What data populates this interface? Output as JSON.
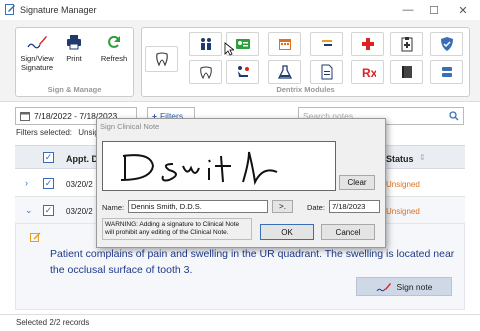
{
  "window": {
    "title": "Signature Manager",
    "min": "—",
    "max": "☐",
    "close": "✕"
  },
  "ribbon": {
    "sign_manage": {
      "label": "Sign & Manage",
      "buttons": [
        {
          "label": "Sign/View Signature",
          "icon": "pen-signature-icon"
        },
        {
          "label": "Print",
          "icon": "printer-icon"
        },
        {
          "label": "Refresh",
          "icon": "refresh-icon"
        }
      ]
    },
    "dentrix_modules": {
      "label": "Dentrix Modules"
    }
  },
  "filter": {
    "date_range": "7/18/2022 - 7/18/2023",
    "filters_label": "Filters",
    "search_placeholder": "Search notes",
    "selected_label": "Filters selected:",
    "selected_value": "Unsig"
  },
  "table": {
    "columns": [
      "Appt. D",
      "Status"
    ],
    "rows": [
      {
        "date": "03/20/2",
        "status": "Unsigned"
      },
      {
        "date": "03/20/2",
        "status": "Unsigned"
      }
    ]
  },
  "note": {
    "text": "Patient complains of pain and swelling in the UR quadrant. The swelling is located near the occlusal surface of tooth 3.",
    "sign_label": "Sign note"
  },
  "status_bar": {
    "text": "Selected 2/2 records"
  },
  "dialog": {
    "title": "Sign Clinical Note",
    "clear_label": "Clear",
    "name_label": "Name:",
    "name_value": "Dennis Smith, D.D.S.",
    "name_btn": ">.",
    "date_label": "Date:",
    "date_value": "7/18/2023",
    "warning": "WARNING: Adding a signature to Clinical Note will prohibit any editing of the Clinical Note.",
    "ok_label": "OK",
    "cancel_label": "Cancel"
  },
  "colors": {
    "accent": "#2a5aa6",
    "unsigned": "#e0701a",
    "note_text": "#1e3a8a"
  }
}
